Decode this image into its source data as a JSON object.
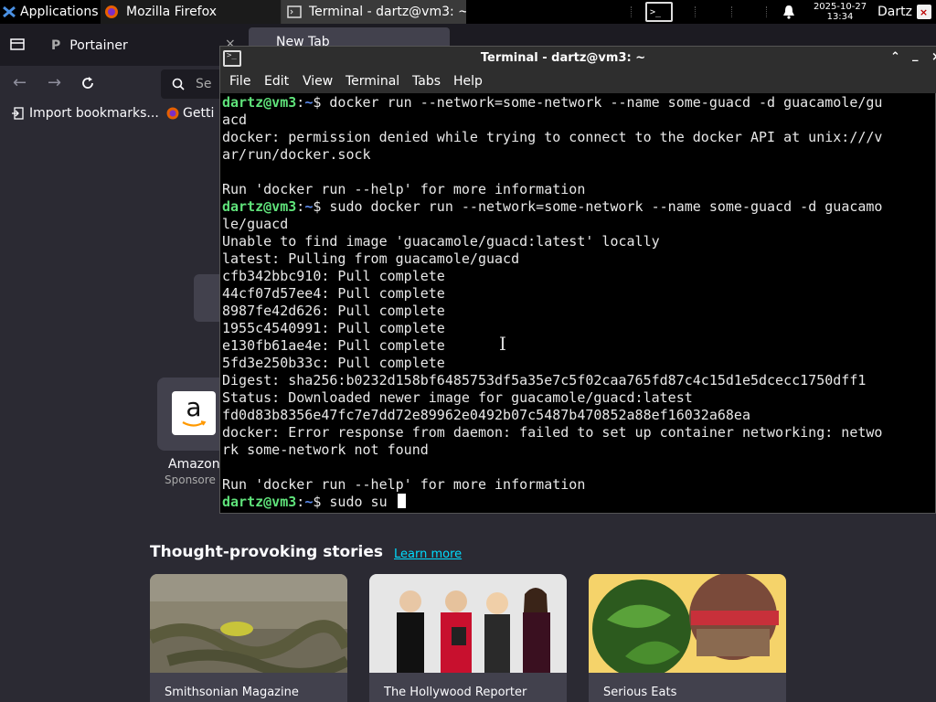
{
  "taskbar": {
    "applications_label": "Applications",
    "tasks": [
      {
        "label": "Mozilla Firefox"
      },
      {
        "label": "Terminal - dartz@vm3: ~"
      }
    ],
    "clock_date": "2025-10-27",
    "clock_time": "13:34",
    "user": "Dartz",
    "logout_glyph": "×"
  },
  "firefox": {
    "tabs": [
      {
        "label": "Portainer",
        "close": "×"
      },
      {
        "label": "New Tab"
      }
    ],
    "url_bar": {
      "partial_text": "Se"
    },
    "bookmarks": {
      "import_label": "Import bookmarks...",
      "getting_started_label": "Getti"
    },
    "shortcuts": [
      {
        "label": "Amazon",
        "sublabel": "Sponsore",
        "logo_letter": "a"
      }
    ],
    "stories": {
      "title": "Thought-provoking stories",
      "learn_more": "Learn more",
      "cards": [
        {
          "source": "Smithsonian Magazine",
          "image": "snake-photo"
        },
        {
          "source": "The Hollywood Reporter",
          "image": "people-photo"
        },
        {
          "source": "Serious Eats",
          "image": "salad-photo"
        }
      ]
    }
  },
  "terminal": {
    "title": "Terminal - dartz@vm3: ~",
    "menu": [
      "File",
      "Edit",
      "View",
      "Terminal",
      "Tabs",
      "Help"
    ],
    "lines": [
      {
        "user": "dartz@vm3",
        "dir": "~",
        "text": "$ docker run --network=some-network --name some-guacd -d guacamole/gu"
      },
      {
        "text": "acd"
      },
      {
        "text": "docker: permission denied while trying to connect to the docker API at unix:///v"
      },
      {
        "text": "ar/run/docker.sock"
      },
      {
        "text": ""
      },
      {
        "text": "Run 'docker run --help' for more information"
      },
      {
        "user": "dartz@vm3",
        "dir": "~",
        "text": "$ sudo docker run --network=some-network --name some-guacd -d guacamo"
      },
      {
        "text": "le/guacd"
      },
      {
        "text": "Unable to find image 'guacamole/guacd:latest' locally"
      },
      {
        "text": "latest: Pulling from guacamole/guacd"
      },
      {
        "text": "cfb342bbc910: Pull complete"
      },
      {
        "text": "44cf07d57ee4: Pull complete"
      },
      {
        "text": "8987fe42d626: Pull complete"
      },
      {
        "text": "1955c4540991: Pull complete"
      },
      {
        "text": "e130fb61ae4e: Pull complete"
      },
      {
        "text": "5fd3e250b33c: Pull complete"
      },
      {
        "text": "Digest: sha256:b0232d158bf6485753df5a35e7c5f02caa765fd87c4c15d1e5dcecc1750dff1"
      },
      {
        "text": "Status: Downloaded newer image for guacamole/guacd:latest"
      },
      {
        "text": "fd0d83b8356e47fc7e7dd72e89962e0492b07c5487b470852a88ef16032a68ea"
      },
      {
        "text": "docker: Error response from daemon: failed to set up container networking: netwo"
      },
      {
        "text": "rk some-network not found"
      },
      {
        "text": ""
      },
      {
        "text": "Run 'docker run --help' for more information"
      },
      {
        "user": "dartz@vm3",
        "dir": "~",
        "text": "$ sudo su "
      }
    ]
  },
  "colors": {
    "prompt_user": "#5fe27a",
    "prompt_dir": "#5c8cf0",
    "link": "#00ddff"
  }
}
